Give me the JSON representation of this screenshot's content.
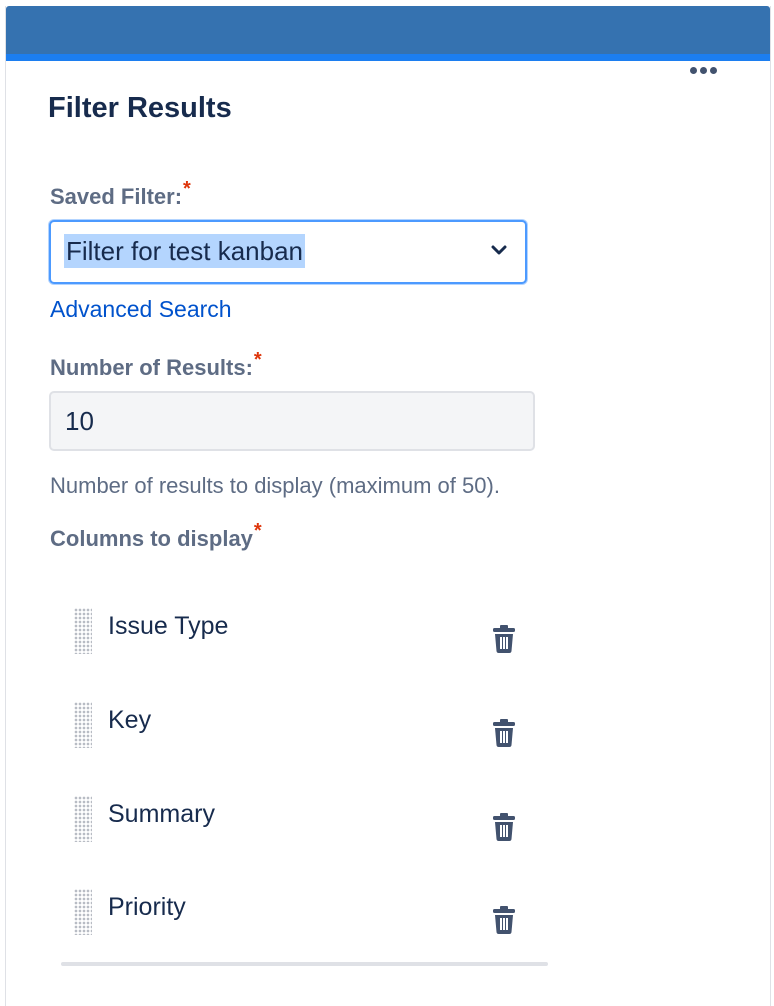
{
  "panel": {
    "title": "Filter Results"
  },
  "saved_filter": {
    "label": "Saved Filter:",
    "required_mark": "*",
    "selected_value": "Filter for test kanban",
    "icon": "chevron-down-icon"
  },
  "advanced_search": {
    "label": "Advanced Search"
  },
  "number_of_results": {
    "label": "Number of Results:",
    "required_mark": "*",
    "value": "10",
    "help": "Number of results to display (maximum of 50)."
  },
  "columns": {
    "label": "Columns to display",
    "required_mark": "*",
    "items": [
      {
        "label": "Issue Type"
      },
      {
        "label": "Key"
      },
      {
        "label": "Summary"
      },
      {
        "label": "Priority"
      }
    ],
    "remove_icon": "trash-icon",
    "drag_icon": "drag-handle-icon"
  },
  "colors": {
    "header": "#3572b0",
    "header_accent": "#1c7ef0",
    "link": "#0052cc",
    "required": "#de350b",
    "focus_border": "#4c9aff"
  }
}
